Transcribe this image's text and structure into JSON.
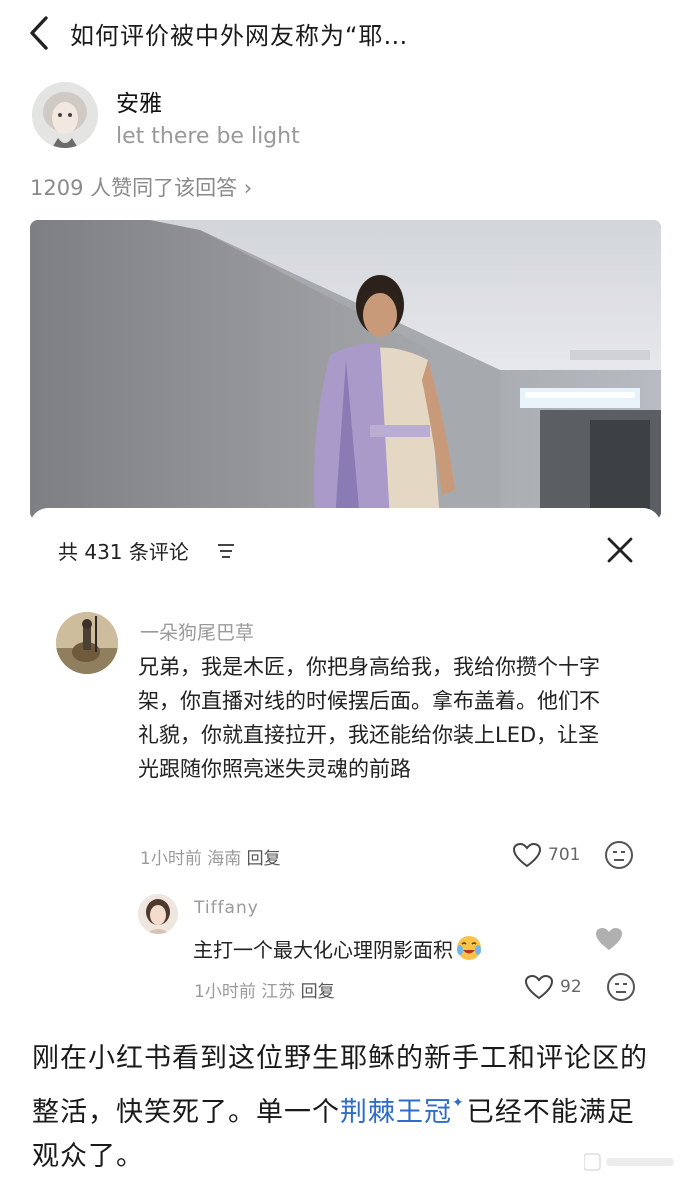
{
  "header": {
    "title": "如何评价被中外网友称为“耶…"
  },
  "author": {
    "name": "安雅",
    "bio": "let there be light"
  },
  "likes_line": "1209 人赞同了该回答 ›",
  "comments_sheet": {
    "count_label": "共 431 条评论",
    "comment": {
      "username": "一朵狗尾巴草",
      "text": "兄弟，我是木匠，你把身高给我，我给你攒个十字架，你直播对线的时候摆后面。拿布盖着。他们不礼貌，你就直接拉开，我还能给你装上LED，让圣光跟随你照亮迷失灵魂的前路",
      "time": "1小时前",
      "location": "海南",
      "reply_label": "回复",
      "likes": "701"
    },
    "reply": {
      "username": "Tiffany",
      "text": "主打一个最大化心理阴影面积",
      "time": "1小时前",
      "location": "江苏",
      "reply_label": "回复",
      "likes": "92"
    }
  },
  "post": {
    "text_before": "刚在小红书看到这位野生耶稣的新手工和评论区的整活，快笑死了。单一个",
    "topic": "荆棘王冠",
    "text_after": "已经不能满足观众了。"
  }
}
